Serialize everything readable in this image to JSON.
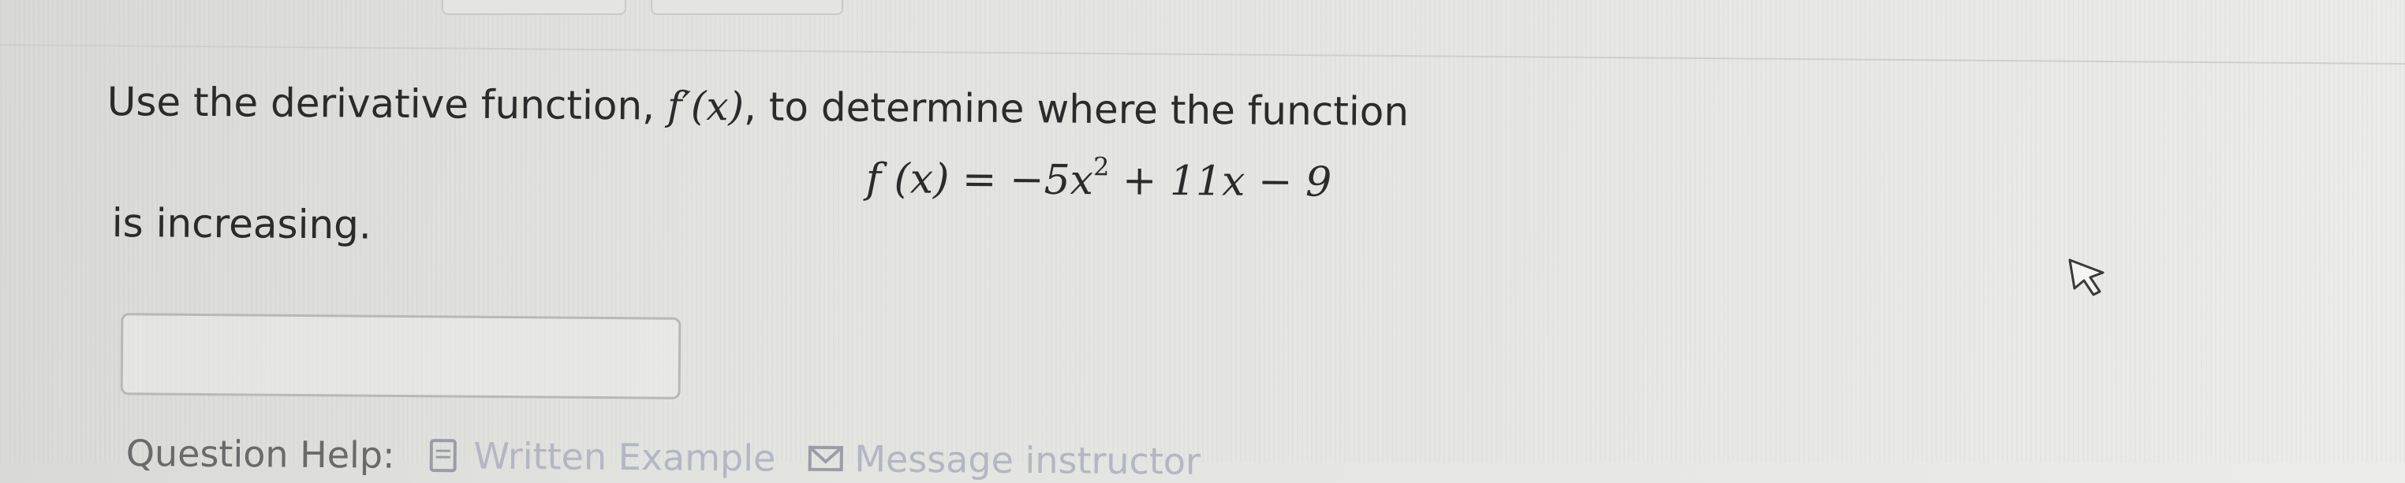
{
  "question": {
    "prompt_start": "Use the derivative function, ",
    "derivative_symbol": "f′(x)",
    "prompt_end": ", to determine where the function",
    "equation": {
      "lhs": "f (x) = −5x",
      "exponent": "2",
      "rhs": " + 11x − 9"
    },
    "suffix": "is increasing."
  },
  "answer": {
    "value": ""
  },
  "help": {
    "label": "Question Help:",
    "written_example_label": "Written Example",
    "message_label": "Message instructor"
  },
  "icons": {
    "written_example": "document-icon",
    "message": "mail-icon",
    "pointer": "mouse-cursor-icon"
  }
}
